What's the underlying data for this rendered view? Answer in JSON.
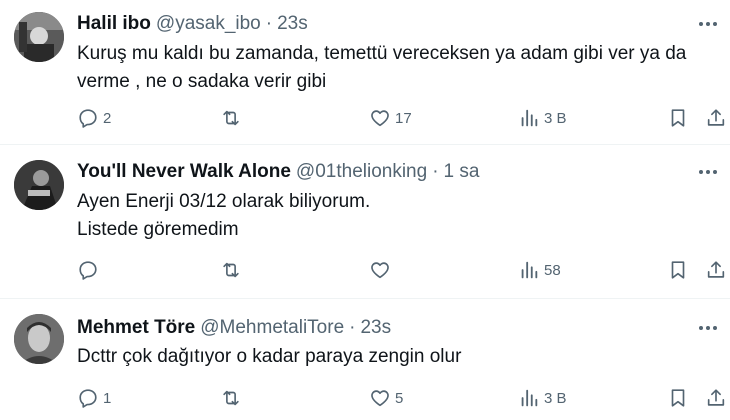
{
  "tweets": [
    {
      "name": "Halil ibo",
      "handle": "@yasak_ibo",
      "dot": "·",
      "time": "23s",
      "lines": [
        "Kuruş mu kaldı bu zamanda, temettü vereceksen ya adam gibi ver ya da",
        "verme , ne o sadaka verir gibi"
      ],
      "replies": "2",
      "retweets": "",
      "likes": "17",
      "views": "3 B"
    },
    {
      "name": "You'll Never Walk Alone",
      "handle": "@01thelionking",
      "dot": "·",
      "time": "1 sa",
      "lines": [
        "Ayen Enerji 03/12 olarak biliyorum.",
        "Listede göremedim"
      ],
      "replies": "",
      "retweets": "",
      "likes": "",
      "views": "58"
    },
    {
      "name": "Mehmet Töre",
      "handle": "@MehmetaliTore",
      "dot": "·",
      "time": "23s",
      "lines": [
        "Dcttr çok dağıtıyor o kadar paraya zengin olur"
      ],
      "replies": "1",
      "retweets": "",
      "likes": "5",
      "views": "3 B"
    }
  ],
  "icons": {
    "reply": "reply-icon",
    "retweet": "retweet-icon",
    "like": "heart-icon",
    "views": "views-icon",
    "bookmark": "bookmark-icon",
    "share": "share-icon",
    "more": "more-icon"
  },
  "colors": {
    "text": "#0f1419",
    "secondary": "#536471",
    "divider": "#eff3f4"
  }
}
